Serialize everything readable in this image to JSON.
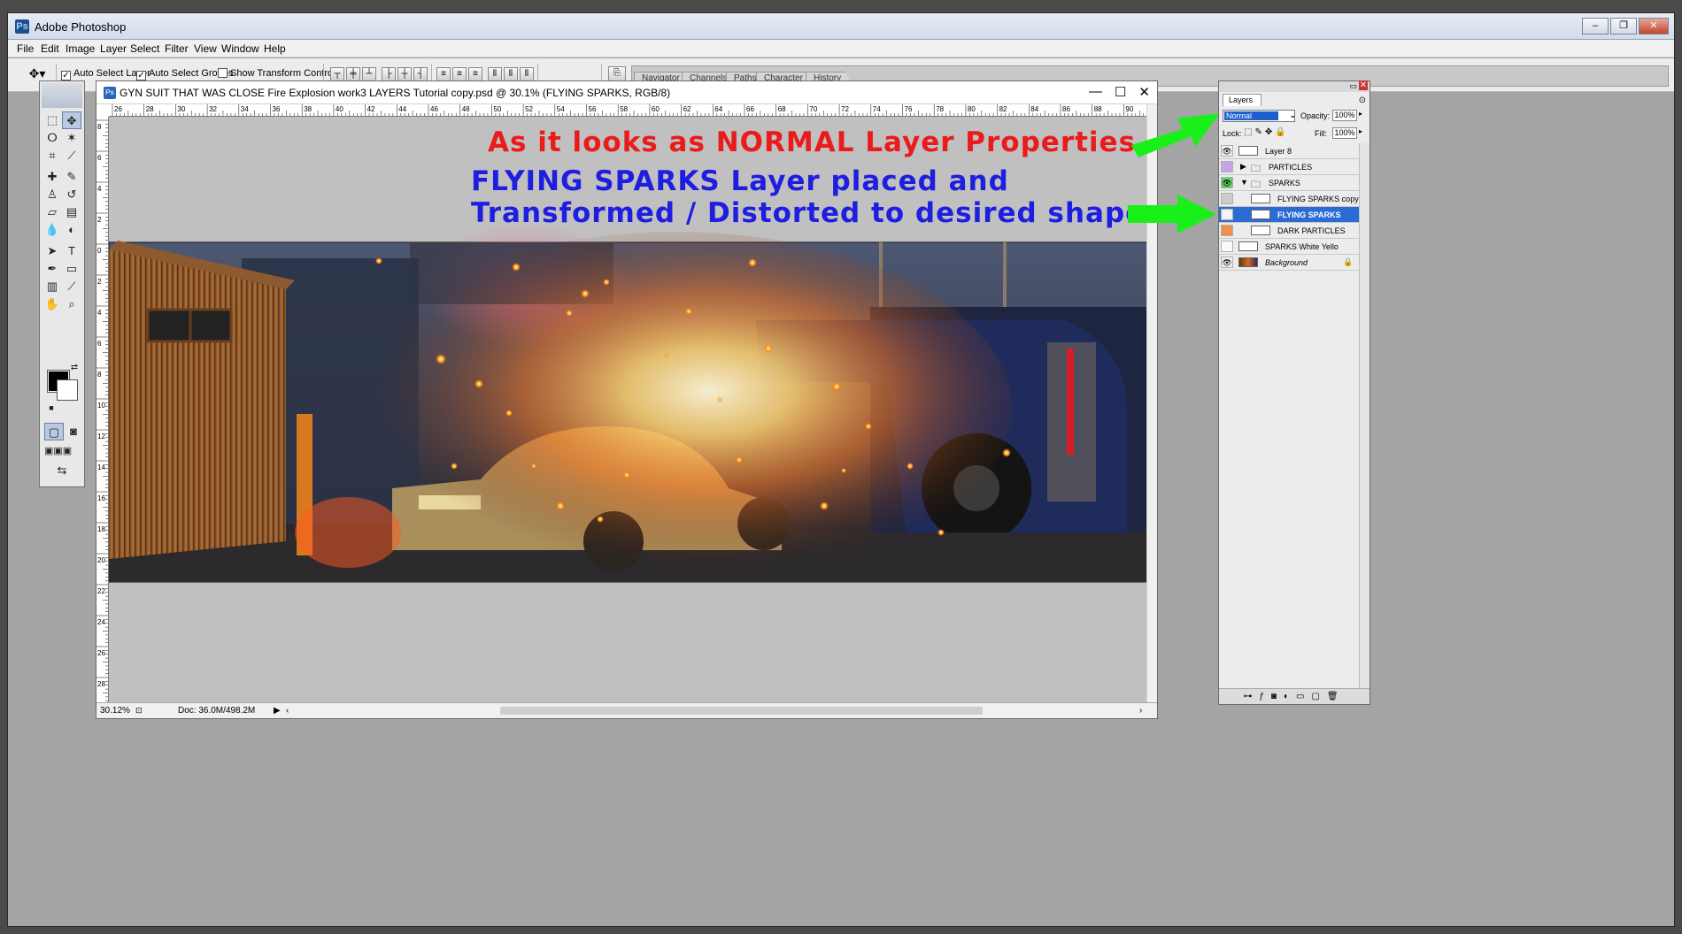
{
  "app": {
    "title": "Adobe Photoshop"
  },
  "window_controls": {
    "minimize": "–",
    "restore": "❐",
    "close": "✕"
  },
  "menu": [
    "File",
    "Edit",
    "Image",
    "Layer",
    "Select",
    "Filter",
    "View",
    "Window",
    "Help"
  ],
  "options_bar": {
    "auto_select_layer": {
      "label": "Auto Select Layer",
      "checked": true
    },
    "auto_select_groups": {
      "label": "Auto Select Groups",
      "checked": true
    },
    "show_transform_controls": {
      "label": "Show Transform Controls",
      "checked": false
    }
  },
  "palette_well": [
    "Navigator",
    "Channels",
    "Paths",
    "Character",
    "History"
  ],
  "document": {
    "title": "GYN SUIT THAT WAS CLOSE Fire Explosion work3 LAYERS Tutorial copy.psd @ 30.1% (FLYING SPARKS, RGB/8)",
    "controls": {
      "minimize": "—",
      "maximize": "☐",
      "close": "✕"
    },
    "ruler_h": [
      "26",
      "28",
      "30",
      "32",
      "34",
      "36",
      "38",
      "40",
      "42",
      "44",
      "46",
      "48",
      "50",
      "52",
      "54",
      "56",
      "58",
      "60",
      "62",
      "64",
      "66",
      "68",
      "70",
      "72",
      "74",
      "76",
      "78",
      "80",
      "82",
      "84",
      "86",
      "88",
      "90"
    ],
    "ruler_v": [
      "8",
      "6",
      "4",
      "2",
      "0",
      "2",
      "4",
      "6",
      "8",
      "10",
      "12",
      "14",
      "16",
      "18",
      "20",
      "22",
      "24",
      "26",
      "28"
    ],
    "zoom": "30.12%",
    "doc_size": "Doc: 36.0M/498.2M"
  },
  "annotations": {
    "normal": "As it looks as NORMAL Layer Properties",
    "line1": "FLYING SPARKS Layer placed and",
    "line2": "Transformed / Distorted to desired shape"
  },
  "layers_panel": {
    "tab": "Layers",
    "blend_mode": "Normal",
    "opacity_label": "Opacity:",
    "opacity": "100%",
    "lock_label": "Lock:",
    "fill_label": "Fill:",
    "fill": "100%",
    "layers": [
      {
        "name": "Layer 8",
        "visible": true,
        "selected": false,
        "indent": 0,
        "type": "layer"
      },
      {
        "name": "PARTICLES",
        "visible": false,
        "selected": false,
        "indent": 0,
        "type": "group-collapsed"
      },
      {
        "name": "SPARKS",
        "visible": true,
        "selected": false,
        "indent": 0,
        "type": "group-expanded"
      },
      {
        "name": "FLYING SPARKS copy",
        "visible": false,
        "selected": false,
        "indent": 1,
        "type": "layer"
      },
      {
        "name": "FLYING SPARKS",
        "visible": true,
        "selected": true,
        "indent": 1,
        "type": "layer"
      },
      {
        "name": "DARK PARTICLES",
        "visible": false,
        "selected": false,
        "indent": 1,
        "type": "layer"
      },
      {
        "name": "SPARKS White Yello",
        "visible": false,
        "selected": false,
        "indent": 0,
        "type": "layer"
      },
      {
        "name": "Background",
        "visible": true,
        "selected": false,
        "indent": 0,
        "type": "background"
      }
    ]
  },
  "colors": {
    "annotation_red": "#ea1b1b",
    "annotation_blue": "#1e1ee0",
    "arrow_green": "#19f019",
    "selection_blue": "#2a6cd4"
  }
}
